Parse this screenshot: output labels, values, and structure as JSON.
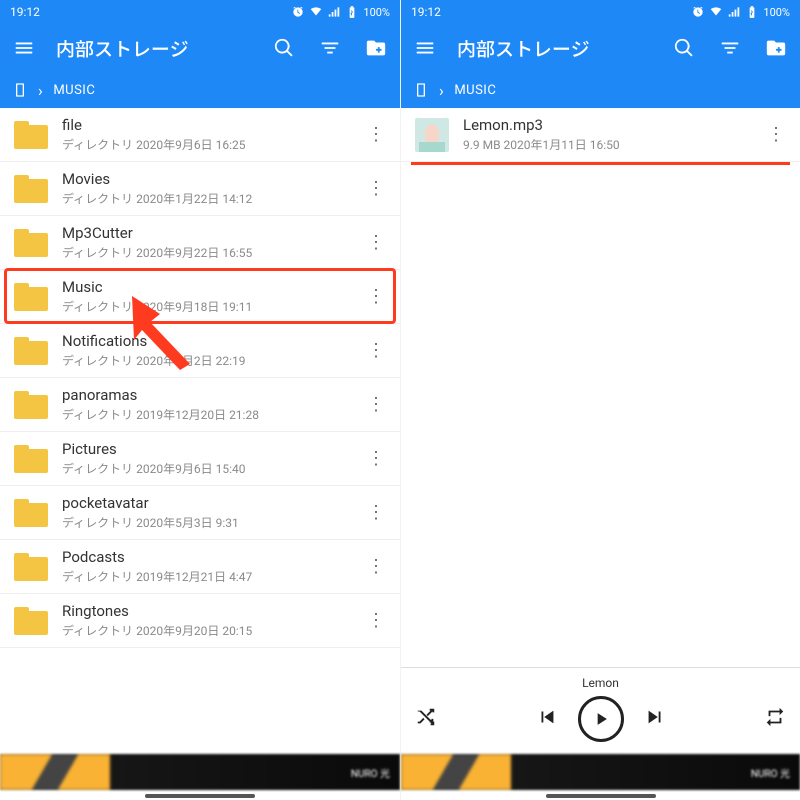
{
  "status": {
    "time": "19:12",
    "battery": "100%"
  },
  "appbar": {
    "title": "内部ストレージ"
  },
  "breadcrumb": {
    "path": "MUSIC"
  },
  "left": {
    "rows": [
      {
        "name": "file",
        "meta": "ディレクトリ  2020年9月6日 16:25"
      },
      {
        "name": "Movies",
        "meta": "ディレクトリ  2020年1月22日 14:12"
      },
      {
        "name": "Mp3Cutter",
        "meta": "ディレクトリ  2020年9月22日 16:55"
      },
      {
        "name": "Music",
        "meta": "ディレクトリ  2020年9月18日 19:11"
      },
      {
        "name": "Notifications",
        "meta": "ディレクトリ  2020年9月2日 22:19"
      },
      {
        "name": "panoramas",
        "meta": "ディレクトリ  2019年12月20日 21:28"
      },
      {
        "name": "Pictures",
        "meta": "ディレクトリ  2020年9月6日 15:40"
      },
      {
        "name": "pocketavatar",
        "meta": "ディレクトリ  2020年5月3日 9:31"
      },
      {
        "name": "Podcasts",
        "meta": "ディレクトリ  2019年12月21日 4:47"
      },
      {
        "name": "Ringtones",
        "meta": "ディレクトリ  2020年9月20日 20:15"
      }
    ],
    "highlight_index": 3
  },
  "right": {
    "file": {
      "name": "Lemon.mp3",
      "meta": "9.9 MB   2020年1月11日 16:50"
    },
    "player": {
      "track": "Lemon"
    }
  },
  "ad": {
    "brand": "NURO 光"
  }
}
